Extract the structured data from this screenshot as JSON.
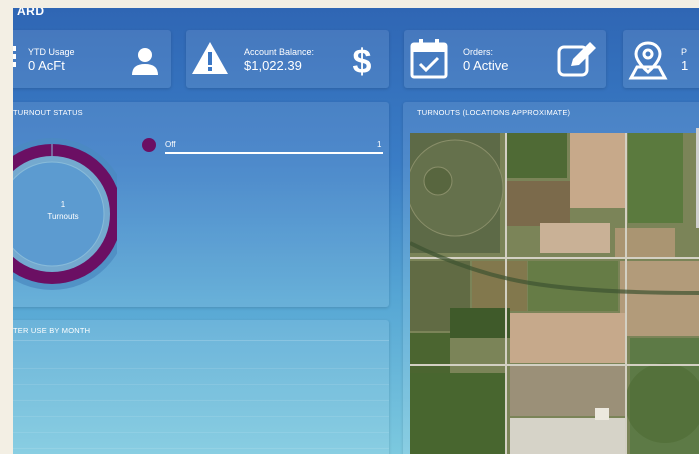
{
  "header": {
    "title": "ARD"
  },
  "stats": {
    "ytd": {
      "label": "YTD Usage",
      "value": "0 AcFt",
      "icon": "user-icon"
    },
    "balance": {
      "label": "Account Balance:",
      "value": "$1,022.39",
      "icon": "warning-icon"
    },
    "orders": {
      "label": "Orders:",
      "value": "0 Active",
      "icon": "calendar-icon"
    },
    "partial": {
      "label": "P",
      "value": "1",
      "icon": "map-pin-icon"
    }
  },
  "turnout_status": {
    "title": "TURNOUT STATUS",
    "center_count": "1",
    "center_label": "Turnouts",
    "legend": [
      {
        "label": "Off",
        "count": "1",
        "color": "#6b0f63"
      }
    ]
  },
  "map_panel": {
    "title": "TURNOUTS (LOCATIONS APPROXIMATE)"
  },
  "water_use": {
    "title": "TER USE BY MONTH"
  },
  "colors": {
    "accent": "#6b0f63",
    "background_top": "#2f66b4",
    "background_bottom": "#7cc9df"
  }
}
